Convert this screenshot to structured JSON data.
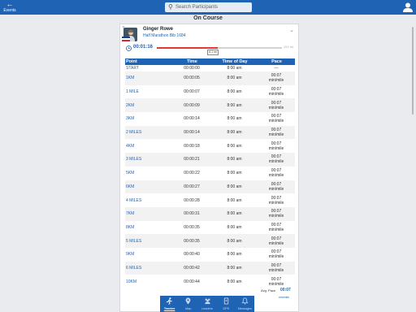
{
  "header": {
    "back_label": "Events",
    "search_placeholder": "Search Participants"
  },
  "page": {
    "title": "On Course"
  },
  "participant": {
    "name": "Ginger Rowe",
    "event": "Half Marathon Bib 1684",
    "elapsed": "00:01:16",
    "progress_fraction": 0.49,
    "marker_label": "6.1 mi",
    "end_label": "13.1 mi"
  },
  "splits": {
    "headers": [
      "Point",
      "Time",
      "Time of Day",
      "Pace"
    ],
    "rows": [
      {
        "point": "START",
        "time": "00:00:00",
        "tod": "8:00 am",
        "pace": "---"
      },
      {
        "point": "1KM",
        "time": "00:00:05",
        "tod": "8:00 am",
        "pace": "00:07\nmin/mile"
      },
      {
        "point": "1 MILE",
        "time": "00:00:07",
        "tod": "8:00 am",
        "pace": "00:07\nmin/mile"
      },
      {
        "point": "2KM",
        "time": "00:00:09",
        "tod": "8:00 am",
        "pace": "00:07\nmin/mile"
      },
      {
        "point": "3KM",
        "time": "00:00:14",
        "tod": "8:00 am",
        "pace": "00:07\nmin/mile"
      },
      {
        "point": "2 MILES",
        "time": "00:00:14",
        "tod": "8:00 am",
        "pace": "00:07\nmin/mile"
      },
      {
        "point": "4KM",
        "time": "00:00:18",
        "tod": "8:00 am",
        "pace": "00:07\nmin/mile"
      },
      {
        "point": "3 MILES",
        "time": "00:00:21",
        "tod": "8:00 am",
        "pace": "00:07\nmin/mile"
      },
      {
        "point": "5KM",
        "time": "00:00:22",
        "tod": "8:00 am",
        "pace": "00:07\nmin/mile"
      },
      {
        "point": "6KM",
        "time": "00:00:27",
        "tod": "8:00 am",
        "pace": "00:07\nmin/mile"
      },
      {
        "point": "4 MILES",
        "time": "00:00:28",
        "tod": "8:00 am",
        "pace": "00:07\nmin/mile"
      },
      {
        "point": "7KM",
        "time": "00:00:31",
        "tod": "8:00 am",
        "pace": "00:07\nmin/mile"
      },
      {
        "point": "8KM",
        "time": "00:00:35",
        "tod": "8:00 am",
        "pace": "00:07\nmin/mile"
      },
      {
        "point": "5 MILES",
        "time": "00:00:35",
        "tod": "8:00 am",
        "pace": "00:07\nmin/mile"
      },
      {
        "point": "9KM",
        "time": "00:00:40",
        "tod": "8:00 am",
        "pace": "00:07\nmin/mile"
      },
      {
        "point": "6 MILES",
        "time": "00:00:42",
        "tod": "8:00 am",
        "pace": "00:07\nmin/mile"
      },
      {
        "point": "10KM",
        "time": "00:00:44",
        "tod": "8:00 am",
        "pace": "00:07\nmin/mile"
      }
    ]
  },
  "average": {
    "label": "Avg. Pace",
    "value": "00:07",
    "unit": "min/mile"
  },
  "bottom_nav": [
    {
      "label": "Tracker",
      "icon": "runner-icon",
      "active": true
    },
    {
      "label": "Map",
      "icon": "map-pin-icon",
      "active": false
    },
    {
      "label": "Leaders",
      "icon": "group-icon",
      "active": false
    },
    {
      "label": "GPS",
      "icon": "gps-icon",
      "active": false
    },
    {
      "label": "Messages",
      "icon": "bell-icon",
      "active": false
    }
  ],
  "colors": {
    "brand": "#1f63b4",
    "progress": "#e53935"
  }
}
